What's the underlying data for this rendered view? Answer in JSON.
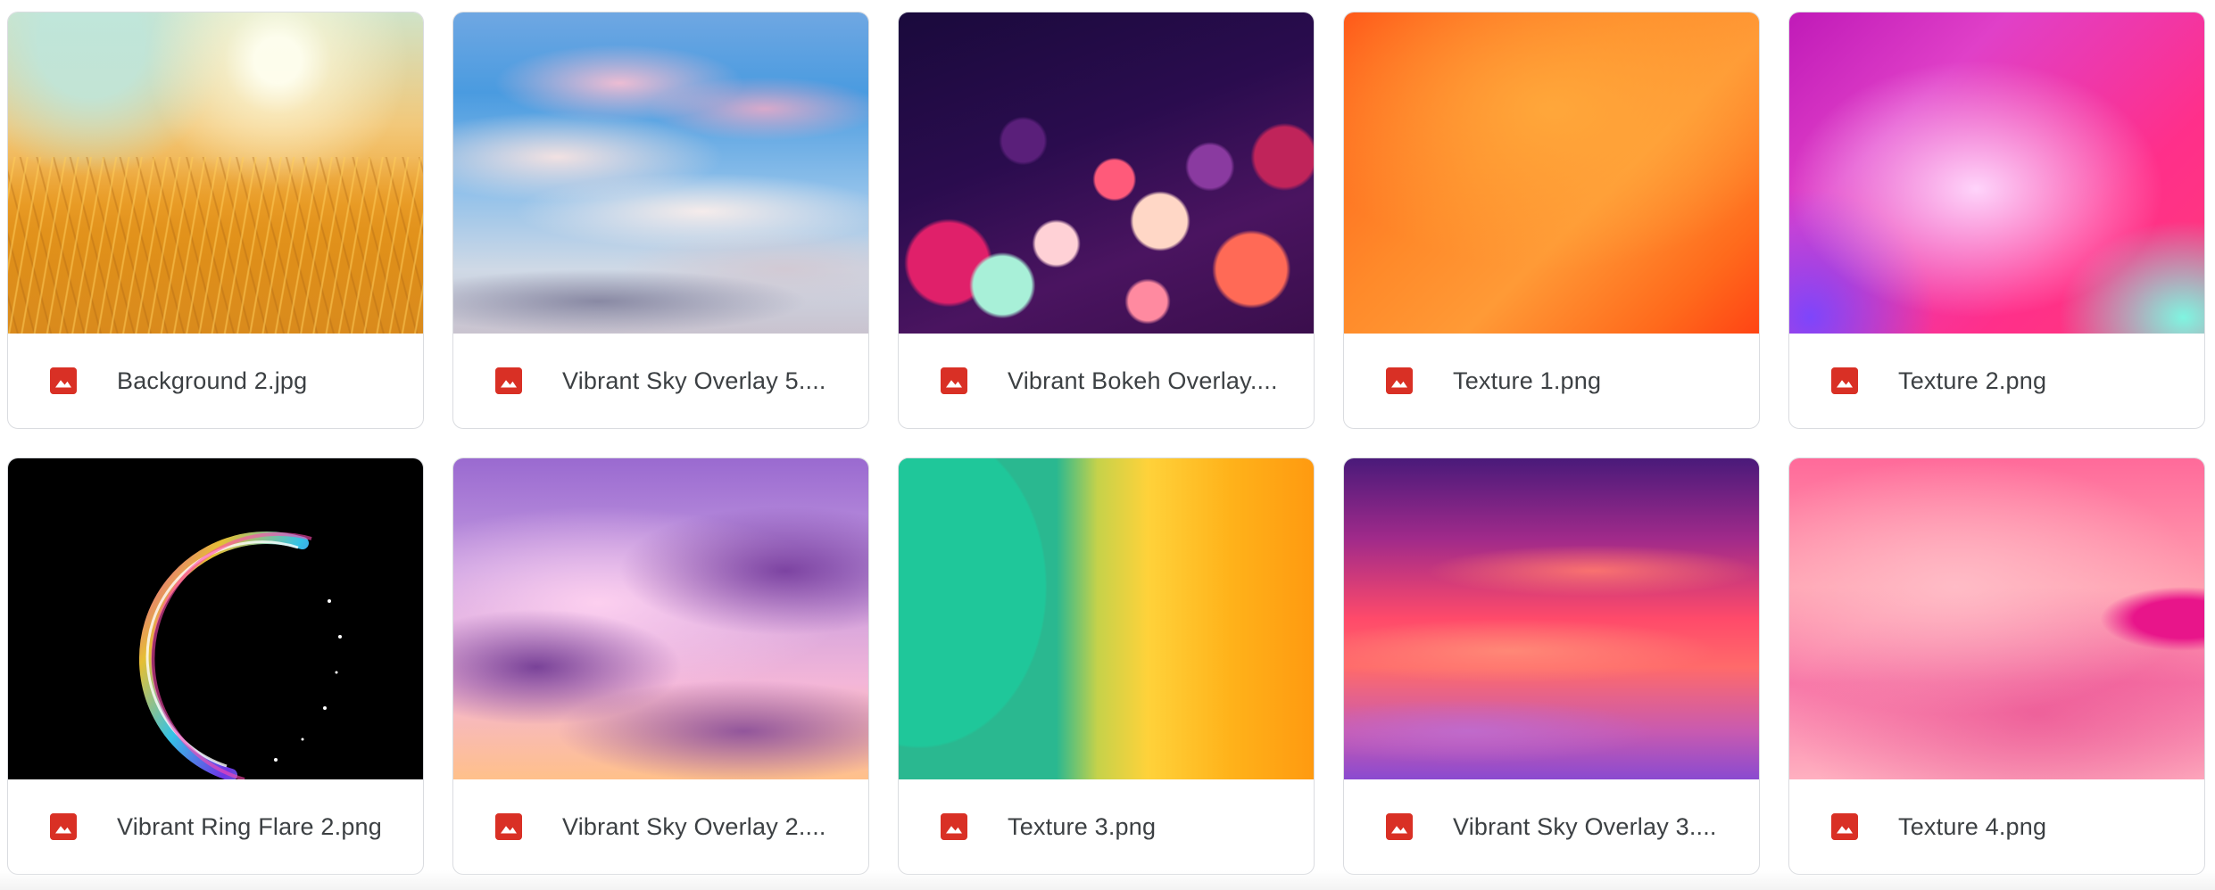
{
  "colors": {
    "file_icon": "#d93025",
    "label_text": "#3c4043",
    "card_border": "#dadce0"
  },
  "files": [
    {
      "name": "Background 2.jpg",
      "icon": "image-file-icon"
    },
    {
      "name": "Vibrant Sky Overlay 5....",
      "icon": "image-file-icon"
    },
    {
      "name": "Vibrant Bokeh Overlay....",
      "icon": "image-file-icon"
    },
    {
      "name": "Texture 1.png",
      "icon": "image-file-icon"
    },
    {
      "name": "Texture 2.png",
      "icon": "image-file-icon"
    },
    {
      "name": "Vibrant Ring Flare 2.png",
      "icon": "image-file-icon"
    },
    {
      "name": "Vibrant Sky Overlay 2....",
      "icon": "image-file-icon"
    },
    {
      "name": "Texture 3.png",
      "icon": "image-file-icon"
    },
    {
      "name": "Vibrant Sky Overlay 3....",
      "icon": "image-file-icon"
    },
    {
      "name": "Texture 4.png",
      "icon": "image-file-icon"
    }
  ]
}
